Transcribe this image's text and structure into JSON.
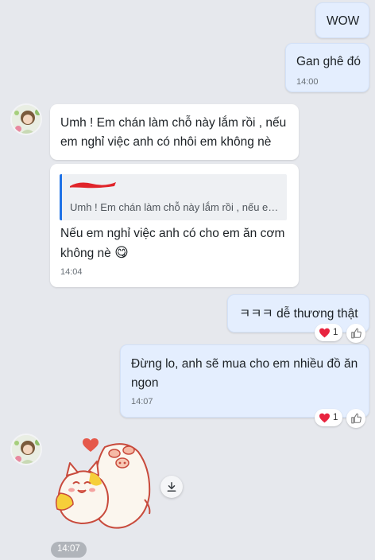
{
  "messages": {
    "m1": {
      "text": "WOW"
    },
    "m2": {
      "text": "Gan ghê đó",
      "time": "14:00"
    },
    "m3": {
      "text": "Umh ! Em chán làm chỗ này lắm rồi , nếu em nghỉ việc anh có nhôi em không nè"
    },
    "m4": {
      "quote_text": "Umh ! Em chán làm chỗ này lắm rồi , nếu em nghỉ việc anh có nhôi em không nè",
      "text": "Nếu em nghỉ việc anh có cho em ăn cơm không nè",
      "emoji": "😋",
      "time": "14:04"
    },
    "m5": {
      "text": "ㅋㅋㅋ dễ thương thật",
      "reaction": {
        "emoji": "❤️",
        "count": "1"
      }
    },
    "m6": {
      "text": "Đừng lo, anh sẽ mua cho em nhiều đồ ăn ngon",
      "time": "14:07",
      "reaction": {
        "emoji": "❤️",
        "count": "1"
      }
    },
    "sticker": {
      "time": "14:07"
    }
  },
  "icons": {
    "avatar": "contact-avatar",
    "heart": "heart-icon",
    "like": "thumbs-up-icon",
    "download": "download-icon",
    "emoji": "yum-face-emoji"
  },
  "colors": {
    "background": "#e6e8ed",
    "my_bubble": "#e4eefe",
    "their_bubble": "#ffffff",
    "quote_bar": "#1f72e6",
    "heart": "#e8243f"
  }
}
